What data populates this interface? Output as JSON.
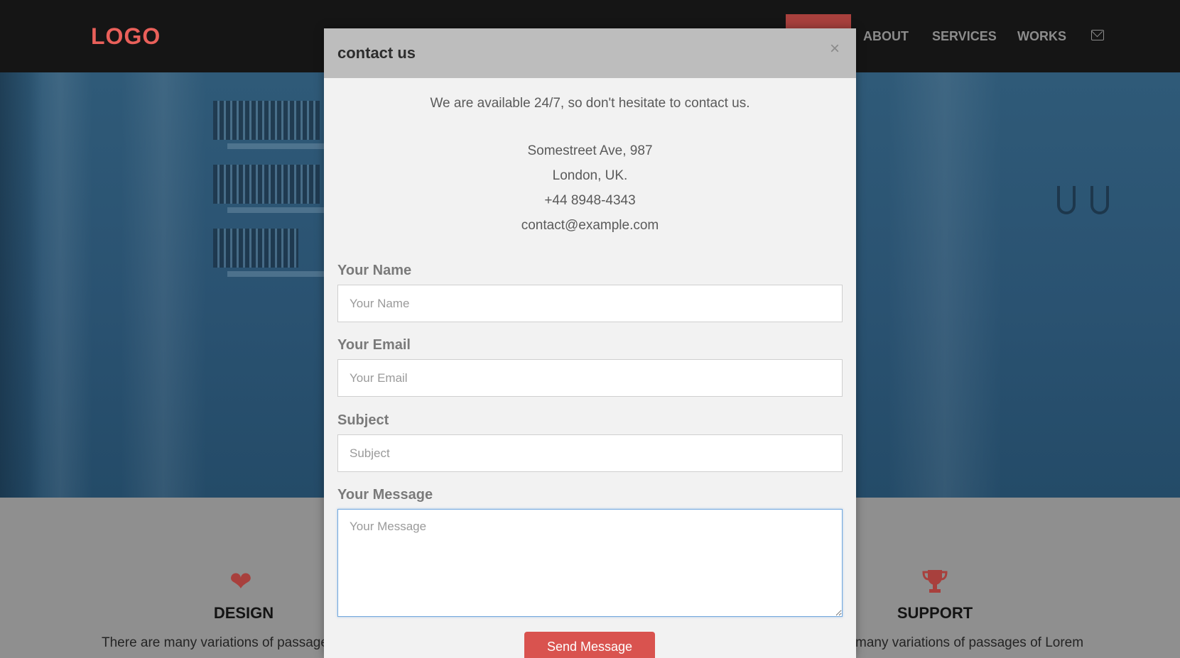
{
  "navbar": {
    "logo": "LOGO",
    "items": [
      {
        "label": "ABOUT"
      },
      {
        "label": "SERVICES"
      },
      {
        "label": "WORKS"
      }
    ],
    "mail_icon": "envelope-icon"
  },
  "features": [
    {
      "icon": "heart-icon",
      "title": "DESIGN",
      "text": "There are many variations of passage"
    },
    {
      "icon": "trophy-icon",
      "title": "SUPPORT",
      "text": "many variations of passages of Lorem"
    }
  ],
  "modal": {
    "title": "contact us",
    "close_label": "×",
    "intro": "We are available 24/7, so don't hesitate to contact us.",
    "address_lines": [
      "Somestreet Ave, 987",
      "London, UK.",
      "+44 8948-4343",
      "contact@example.com"
    ],
    "fields": {
      "name": {
        "label": "Your Name",
        "placeholder": "Your Name",
        "value": ""
      },
      "email": {
        "label": "Your Email",
        "placeholder": "Your Email",
        "value": ""
      },
      "subject": {
        "label": "Subject",
        "placeholder": "Subject",
        "value": ""
      },
      "message": {
        "label": "Your Message",
        "placeholder": "Your Message",
        "value": ""
      }
    },
    "send_label": "Send Message"
  },
  "colors": {
    "accent": "#d9534f",
    "logo": "#e9605a",
    "navbar": "#151515",
    "hero": "#2a5271",
    "focus_border": "#74a9de"
  }
}
